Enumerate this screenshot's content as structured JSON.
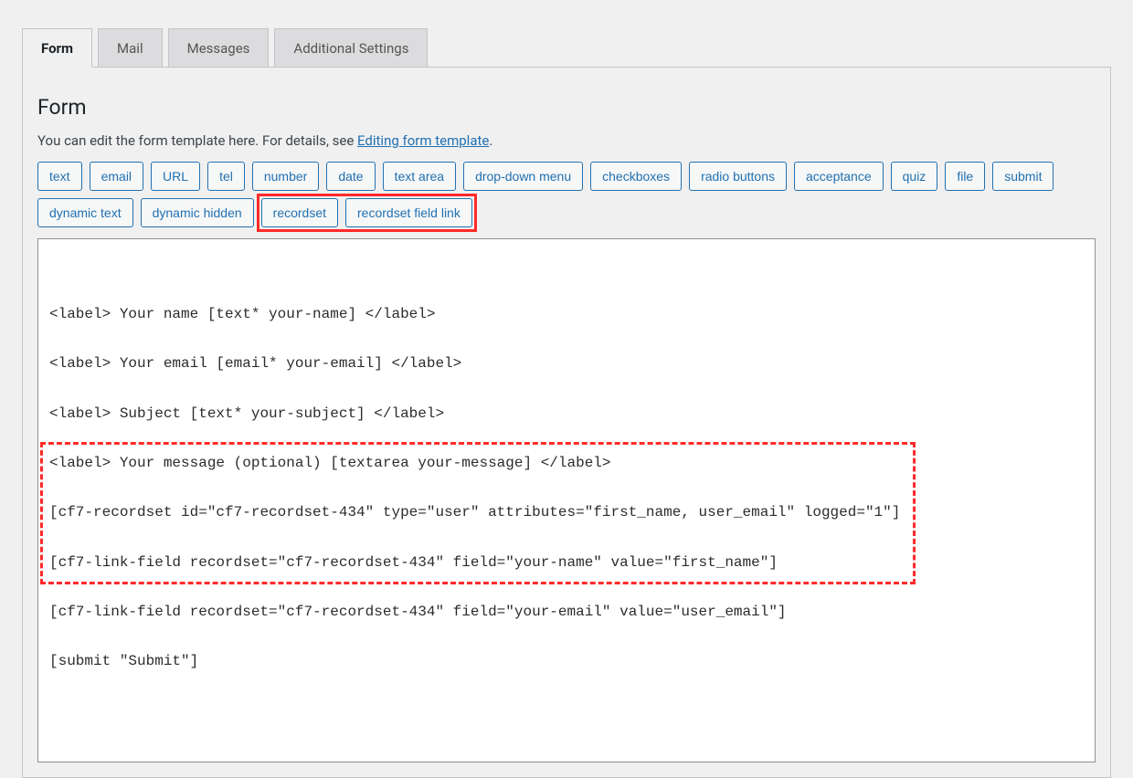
{
  "tabs": {
    "form": "Form",
    "mail": "Mail",
    "messages": "Messages",
    "additional": "Additional Settings"
  },
  "panel": {
    "heading": "Form",
    "desc_prefix": "You can edit the form template here. For details, see ",
    "desc_link": "Editing form template",
    "desc_suffix": "."
  },
  "tagbuttons": {
    "text": "text",
    "email": "email",
    "url": "URL",
    "tel": "tel",
    "number": "number",
    "date": "date",
    "textarea": "text area",
    "dropdown": "drop-down menu",
    "checkboxes": "checkboxes",
    "radio": "radio buttons",
    "acceptance": "acceptance",
    "quiz": "quiz",
    "file": "file",
    "submit": "submit",
    "dyntext": "dynamic text",
    "dynhidden": "dynamic hidden",
    "recordset": "recordset",
    "recordsetfl": "recordset field link"
  },
  "code": "<label> Your name [text* your-name] </label>\n\n<label> Your email [email* your-email] </label>\n\n<label> Subject [text* your-subject] </label>\n\n<label> Your message (optional) [textarea your-message] </label>\n\n[cf7-recordset id=\"cf7-recordset-434\" type=\"user\" attributes=\"first_name, user_email\" logged=\"1\"]\n\n[cf7-link-field recordset=\"cf7-recordset-434\" field=\"your-name\" value=\"first_name\"]\n\n[cf7-link-field recordset=\"cf7-recordset-434\" field=\"your-email\" value=\"user_email\"]\n\n[submit \"Submit\"]"
}
